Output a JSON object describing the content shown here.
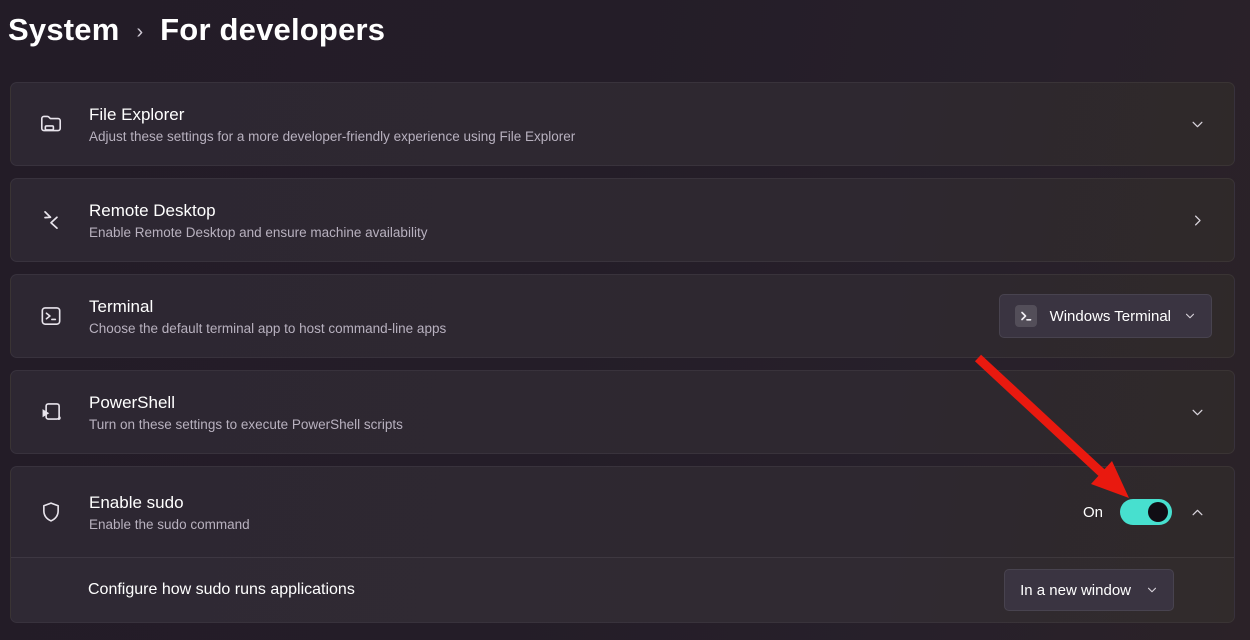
{
  "header": {
    "section": "System",
    "separator": "›",
    "page": "For developers"
  },
  "cards": [
    {
      "title": "File Explorer",
      "description": "Adjust these settings for a more developer-friendly experience using File Explorer",
      "icon": "folder-icon",
      "control": "chevron-down"
    },
    {
      "title": "Remote Desktop",
      "description": "Enable Remote Desktop and ensure machine availability",
      "icon": "remote-desktop-icon",
      "control": "chevron-right"
    },
    {
      "title": "Terminal",
      "description": "Choose the default terminal app to host command-line apps",
      "icon": "terminal-icon",
      "dropdown": {
        "value": "Windows Terminal",
        "icon": "windows-terminal-glyph"
      }
    },
    {
      "title": "PowerShell",
      "description": "Turn on these settings to execute PowerShell scripts",
      "icon": "powershell-icon",
      "control": "chevron-down"
    },
    {
      "title": "Enable sudo",
      "description": "Enable the sudo command",
      "icon": "shield-icon",
      "toggle": {
        "label": "On",
        "state": "on"
      },
      "control": "chevron-up",
      "subrow": {
        "label": "Configure how sudo runs applications",
        "dropdown": {
          "value": "In a new window"
        }
      }
    }
  ],
  "colors": {
    "accent_toggle": "#47e0cf",
    "annotation_arrow": "#e9190f",
    "card_background": "#2d2732",
    "page_background": "#241d28"
  }
}
